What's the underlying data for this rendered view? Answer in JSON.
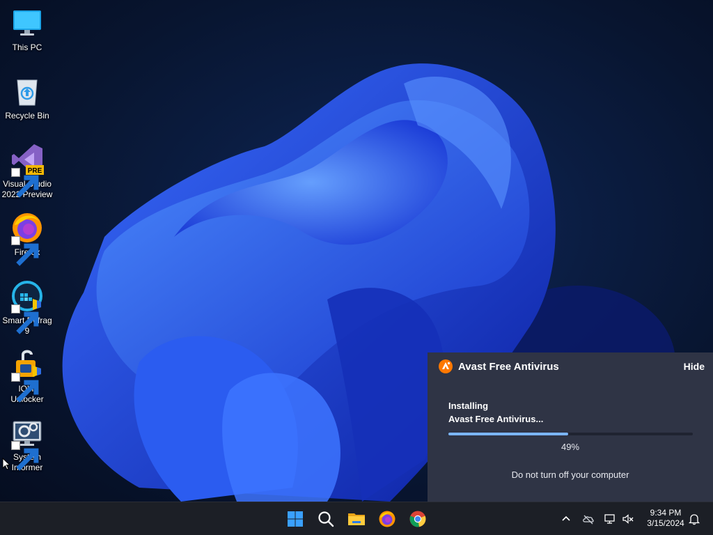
{
  "desktop": {
    "icons": [
      {
        "label": "This PC"
      },
      {
        "label": "Recycle Bin"
      },
      {
        "label": "Visual Studio\n2022 Preview",
        "badge": "PRE"
      },
      {
        "label": "Firefox"
      },
      {
        "label": "Smart Defrag\n9"
      },
      {
        "label": "IObit\nUnlocker"
      },
      {
        "label": "System\nInformer"
      }
    ]
  },
  "avast": {
    "title": "Avast Free Antivirus",
    "hide_label": "Hide",
    "installing_line1": "Installing",
    "installing_line2": "Avast Free Antivirus...",
    "progress_fraction": 0.49,
    "progress_text": "49%",
    "warning": "Do not turn off your computer",
    "accent": "#7bb5ff",
    "brand": "#ff7800"
  },
  "taskbar": {
    "pinned": [
      "windows-start-icon",
      "search-icon",
      "file-explorer-icon",
      "firefox-icon",
      "chrome-icon"
    ],
    "tray": [
      "chevron-up-icon",
      "onedrive-offline-icon",
      "network-icon",
      "volume-muted-icon",
      "notification-bell-icon"
    ],
    "clock": {
      "time": "9:34 PM",
      "date": "3/15/2024"
    }
  }
}
